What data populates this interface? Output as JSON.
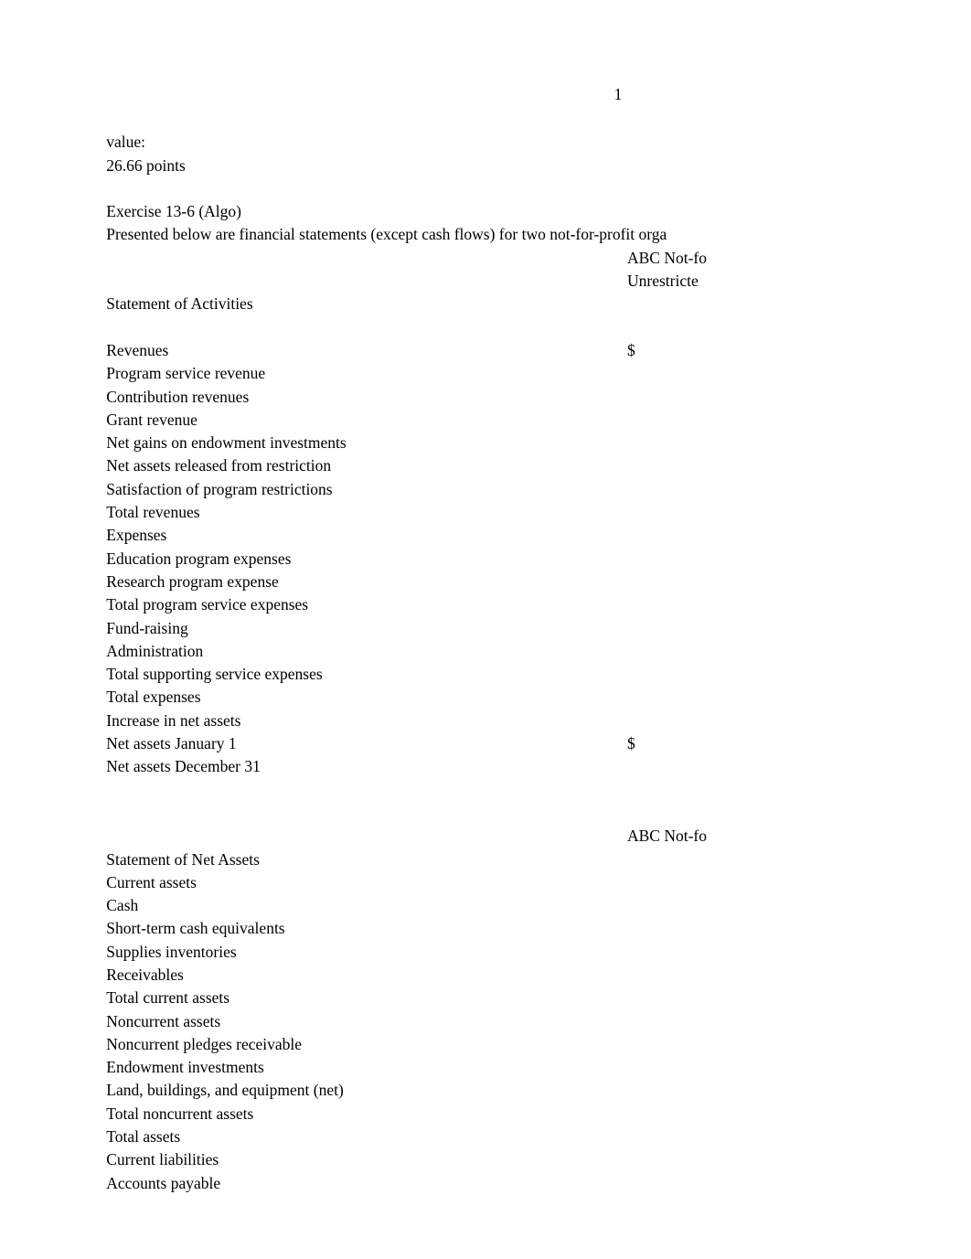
{
  "page": {
    "number": "1"
  },
  "header": {
    "value_label": "value:",
    "points": "26.66 points"
  },
  "exercise": {
    "title": "Exercise 13-6 (Algo)",
    "description": "Presented below are financial statements (except cash flows) for two not-for-profit orga"
  },
  "statement_of_activities": {
    "org_header": "ABC Not-fo",
    "column_header": "Unrestricte",
    "title": "Statement of Activities",
    "rows": [
      {
        "label": "Revenues",
        "amount": ""
      },
      {
        "label": "Program service revenue",
        "amount": "$"
      },
      {
        "label": "Contribution revenues",
        "amount": ""
      },
      {
        "label": "Grant revenue",
        "amount": ""
      },
      {
        "label": "Net gains on endowment investments",
        "amount": ""
      },
      {
        "label": "Net assets released from restriction",
        "amount": ""
      },
      {
        "label": "Satisfaction of program restrictions",
        "amount": ""
      },
      {
        "label": "Total revenues",
        "amount": ""
      },
      {
        "label": "Expenses",
        "amount": ""
      },
      {
        "label": "Education program expenses",
        "amount": ""
      },
      {
        "label": "Research program expense",
        "amount": ""
      },
      {
        "label": "Total program service expenses",
        "amount": ""
      },
      {
        "label": "Fund-raising",
        "amount": ""
      },
      {
        "label": "Administration",
        "amount": ""
      },
      {
        "label": "Total supporting service expenses",
        "amount": ""
      },
      {
        "label": "Total expenses",
        "amount": ""
      },
      {
        "label": "Increase in net assets",
        "amount": ""
      },
      {
        "label": "Net assets January 1",
        "amount": ""
      },
      {
        "label": "Net assets December 31",
        "amount": "$"
      }
    ]
  },
  "statement_of_net_assets": {
    "title": "Statement of Net Assets",
    "org_header": "ABC Not-fo",
    "rows": [
      {
        "label": "Current assets",
        "amount": ""
      },
      {
        "label": "Cash",
        "amount": ""
      },
      {
        "label": "Short-term cash equivalents",
        "amount": ""
      },
      {
        "label": "Supplies inventories",
        "amount": ""
      },
      {
        "label": "Receivables",
        "amount": ""
      },
      {
        "label": "Total current assets",
        "amount": ""
      },
      {
        "label": "Noncurrent assets",
        "amount": ""
      },
      {
        "label": "Noncurrent pledges receivable",
        "amount": ""
      },
      {
        "label": "Endowment investments",
        "amount": ""
      },
      {
        "label": "Land, buildings, and equipment (net)",
        "amount": ""
      },
      {
        "label": "Total noncurrent assets",
        "amount": ""
      },
      {
        "label": "Total assets",
        "amount": ""
      },
      {
        "label": "Current liabilities",
        "amount": ""
      },
      {
        "label": "Accounts payable",
        "amount": ""
      }
    ]
  }
}
